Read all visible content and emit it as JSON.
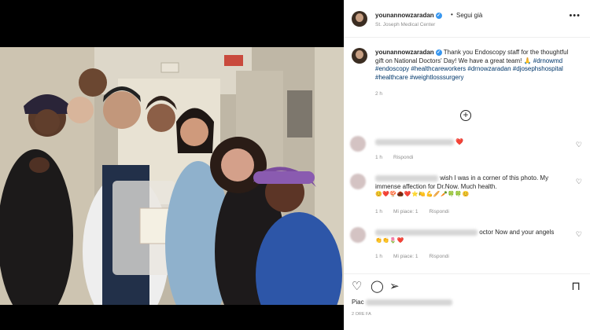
{
  "header": {
    "username": "younannowzaradan",
    "verified_icon": "verified-badge-icon",
    "separator": "•",
    "follow_label": "Segui già",
    "location": "St. Joseph Medical Center",
    "more_icon": "more-horizontal-icon"
  },
  "caption": {
    "username": "younannowzaradan",
    "text": "Thank you Endoscopy staff for the thoughtful gift on National Doctors' Day! We have a great team! 🙏",
    "hashtags": "#drnowmd #endoscopy #healthcareworkers #drnowzaradan #djosephshospital #healthcare #weightlosssurgery",
    "age": "2 h"
  },
  "load_more_icon": "plus-circle-icon",
  "comments": [
    {
      "text_visible": "❤️",
      "meta_time": "1 h",
      "meta_reply": "Rispondi"
    },
    {
      "text_visible": "wish I was in a corner of this photo. My immense affection for Dr.Now. Much health.",
      "emojis": "😊❤️🍄🌰❤️⭐🍋💪🥖🥕🍀🍀😊",
      "meta_time": "1 h",
      "meta_likes": "Mi piace: 1",
      "meta_reply": "Rispondi"
    },
    {
      "text_visible": "octor Now and your angels",
      "emojis": "👏👏🌷❤️",
      "meta_time": "1 h",
      "meta_likes": "Mi piace: 1",
      "meta_reply": "Rispondi"
    }
  ],
  "actions": {
    "like_icon": "heart-outline-icon",
    "comment_icon": "comment-bubble-icon",
    "share_icon": "paper-plane-icon",
    "save_icon": "bookmark-icon"
  },
  "likes_prefix": "Piac",
  "date_prefix": "2 ORE FA",
  "colors": {
    "link": "#00376b",
    "verified": "#3897f0",
    "muted": "#8e8e8e",
    "text": "#262626",
    "heart": "#ed4956"
  }
}
